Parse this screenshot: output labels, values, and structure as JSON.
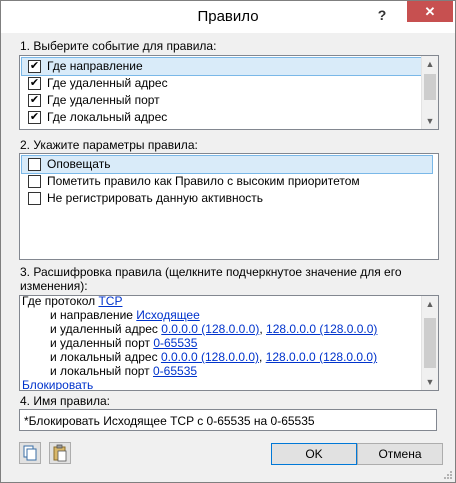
{
  "window": {
    "title": "Правило",
    "help_label": "?",
    "close_label": "✕"
  },
  "section1": {
    "label": "1. Выберите событие для правила:",
    "items": [
      {
        "label": "Где направление",
        "checked": true,
        "selected": true
      },
      {
        "label": "Где удаленный адрес",
        "checked": true
      },
      {
        "label": "Где удаленный порт",
        "checked": true
      },
      {
        "label": "Где локальный адрес",
        "checked": true
      }
    ]
  },
  "section2": {
    "label": "2. Укажите параметры правила:",
    "items": [
      {
        "label": "Оповещать",
        "checked": false,
        "selected": true
      },
      {
        "label": "Пометить правило как Правило с высоким приоритетом",
        "checked": false
      },
      {
        "label": "Не регистрировать данную активность",
        "checked": false
      }
    ]
  },
  "section3": {
    "label": "3. Расшифровка правила (щелкните подчеркнутое значение для его изменения):",
    "line1_text": "Где протокол ",
    "line1_link": "TCP",
    "line2_text": "и направление ",
    "line2_link": "Исходящее",
    "line3_text": "и удаленный адрес ",
    "line3_link1": "0.0.0.0 (128.0.0.0)",
    "line3_sep": ", ",
    "line3_link2": "128.0.0.0 (128.0.0.0)",
    "line4_text": "и удаленный порт ",
    "line4_link": "0-65535",
    "line5_text": "и локальный адрес ",
    "line5_link1": "0.0.0.0 (128.0.0.0)",
    "line5_sep": ", ",
    "line5_link2": "128.0.0.0 (128.0.0.0)",
    "line6_text": "и локальный порт ",
    "line6_link": "0-65535",
    "line7_link": "Блокировать"
  },
  "section4": {
    "label": "4. Имя правила:",
    "value": "*Блокировать Исходящее TCP с 0-65535 на 0-65535"
  },
  "buttons": {
    "ok": "OK",
    "cancel": "Отмена"
  },
  "icons": {
    "copy": "copy-icon",
    "paste": "paste-icon",
    "close": "close-icon",
    "help": "help-icon"
  }
}
